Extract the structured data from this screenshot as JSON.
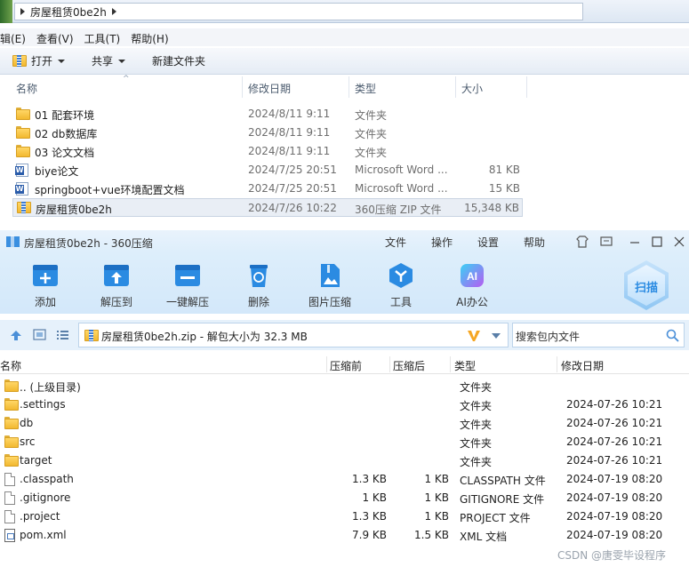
{
  "explorer": {
    "breadcrumb": "房屋租赁0be2h",
    "menu": [
      "辑(E)",
      "查看(V)",
      "工具(T)",
      "帮助(H)"
    ],
    "toolbar": {
      "open": "打开",
      "share": "共享",
      "new_folder": "新建文件夹"
    },
    "columns": {
      "name": "名称",
      "date": "修改日期",
      "type": "类型",
      "size": "大小"
    },
    "rows": [
      {
        "icon": "folder-icon",
        "name": "01 配套环境",
        "date": "2024/8/11 9:11",
        "type": "文件夹",
        "size": ""
      },
      {
        "icon": "folder-icon",
        "name": "02 db数据库",
        "date": "2024/8/11 9:11",
        "type": "文件夹",
        "size": ""
      },
      {
        "icon": "folder-icon",
        "name": "03 论文文档",
        "date": "2024/8/11 9:11",
        "type": "文件夹",
        "size": ""
      },
      {
        "icon": "word-doc-icon",
        "name": "biye论文",
        "date": "2024/7/25 20:51",
        "type": "Microsoft Word ...",
        "size": "81 KB"
      },
      {
        "icon": "word-doc-icon",
        "name": "springboot+vue环境配置文档",
        "date": "2024/7/25 20:51",
        "type": "Microsoft Word ...",
        "size": "15 KB"
      },
      {
        "icon": "zip-archive-icon",
        "name": "房屋租赁0be2h",
        "date": "2024/7/26 10:22",
        "type": "360压缩 ZIP 文件",
        "size": "15,348 KB",
        "selected": true
      }
    ]
  },
  "archive": {
    "title": "房屋租赁0be2h - 360压缩",
    "menu": [
      "文件",
      "操作",
      "设置",
      "帮助"
    ],
    "ribbon": [
      {
        "icon": "add-icon",
        "label": "添加"
      },
      {
        "icon": "extract-to-icon",
        "label": "解压到"
      },
      {
        "icon": "one-click-extract-icon",
        "label": "一键解压"
      },
      {
        "icon": "delete-icon",
        "label": "删除"
      },
      {
        "icon": "image-compress-icon",
        "label": "图片压缩"
      },
      {
        "icon": "tools-icon",
        "label": "工具"
      },
      {
        "icon": "ai-office-icon",
        "label": "AI办公"
      }
    ],
    "scan_label": "扫描",
    "path_text": "房屋租赁0be2h.zip - 解包大小为 32.3 MB",
    "search_placeholder": "搜索包内文件",
    "columns": {
      "name": "名称",
      "compressed": "压缩前",
      "after": "压缩后",
      "type": "类型",
      "date": "修改日期"
    },
    "rows": [
      {
        "icon": "folder-icon",
        "name": ".. (上级目录)",
        "before": "",
        "after": "",
        "type": "文件夹",
        "date": ""
      },
      {
        "icon": "folder-icon",
        "name": ".settings",
        "before": "",
        "after": "",
        "type": "文件夹",
        "date": "2024-07-26 10:21"
      },
      {
        "icon": "folder-icon",
        "name": "db",
        "before": "",
        "after": "",
        "type": "文件夹",
        "date": "2024-07-26 10:21"
      },
      {
        "icon": "folder-icon",
        "name": "src",
        "before": "",
        "after": "",
        "type": "文件夹",
        "date": "2024-07-26 10:21"
      },
      {
        "icon": "folder-icon",
        "name": "target",
        "before": "",
        "after": "",
        "type": "文件夹",
        "date": "2024-07-26 10:21"
      },
      {
        "icon": "file-icon",
        "name": ".classpath",
        "before": "1.3 KB",
        "after": "1 KB",
        "type": "CLASSPATH 文件",
        "date": "2024-07-19 08:20"
      },
      {
        "icon": "file-icon",
        "name": ".gitignore",
        "before": "1 KB",
        "after": "1 KB",
        "type": "GITIGNORE 文件",
        "date": "2024-07-19 08:20"
      },
      {
        "icon": "file-icon",
        "name": ".project",
        "before": "1.3 KB",
        "after": "1 KB",
        "type": "PROJECT 文件",
        "date": "2024-07-19 08:20"
      },
      {
        "icon": "xml-file-icon",
        "name": "pom.xml",
        "before": "7.9 KB",
        "after": "1.5 KB",
        "type": "XML 文档",
        "date": "2024-07-19 08:20"
      }
    ]
  },
  "watermark": "CSDN @唐雯毕设程序",
  "colors": {
    "accent": "#2b8be2",
    "ribbon_bg": "#d3e8fa",
    "selection": "#e9eef5"
  }
}
